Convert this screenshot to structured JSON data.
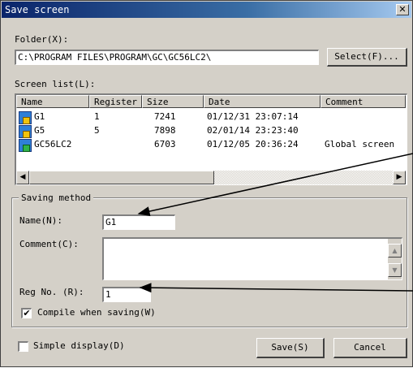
{
  "window": {
    "title": "Save screen",
    "close_glyph": "✕"
  },
  "folder": {
    "label": "Folder(X):",
    "path": "C:\\PROGRAM FILES\\PROGRAM\\GC\\GC56LC2\\",
    "select_button": "Select(F)..."
  },
  "screen_list": {
    "label": "Screen list(L):",
    "columns": [
      "Name",
      "Register",
      "Size",
      "Date",
      "Comment"
    ],
    "rows": [
      {
        "icon": "screen-icon",
        "name": "G1",
        "register": "1",
        "size": "7241",
        "date": "01/12/31 23:07:14",
        "comment": ""
      },
      {
        "icon": "screen-icon",
        "name": "G5",
        "register": "5",
        "size": "7898",
        "date": "02/01/14 23:23:40",
        "comment": ""
      },
      {
        "icon": "global-screen-icon",
        "name": "GC56LC2",
        "register": "",
        "size": "6703",
        "date": "01/12/05 20:36:24",
        "comment": "Global screen"
      }
    ],
    "scroll_left": "◀",
    "scroll_right": "▶"
  },
  "saving_method": {
    "title": "Saving method",
    "name_label": "Name(N):",
    "name_value": "G1",
    "comment_label": "Comment(C):",
    "comment_value": "",
    "scroll_up": "▲",
    "scroll_down": "▼",
    "regno_label": "Reg No. (R):",
    "regno_value": "1",
    "compile_label": "Compile when saving(W)",
    "compile_checked": "✔"
  },
  "footer": {
    "simple_display_label": "Simple display(D)",
    "save_button": "Save(S)",
    "cancel_button": "Cancel"
  }
}
